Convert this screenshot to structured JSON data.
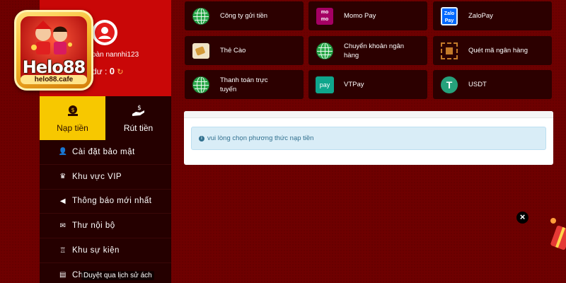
{
  "logo": {
    "text": "Helo88",
    "url": "helo88.cafe"
  },
  "profile": {
    "username": "oàn nannhi123",
    "balance_prefix": "dư :",
    "balance_value": "0"
  },
  "tabs": [
    {
      "label": "Nạp tiền",
      "active": true
    },
    {
      "label": "Rút tiền",
      "active": false
    }
  ],
  "menu": [
    {
      "label": "Cài đặt bảo mật",
      "icon": "user-lock-icon"
    },
    {
      "label": "Khu vực VIP",
      "icon": "crown-icon"
    },
    {
      "label": "Thông báo mới nhất",
      "icon": "megaphone-icon"
    },
    {
      "label": "Thư nội bộ",
      "icon": "envelope-icon"
    },
    {
      "label": "Khu sự kiện",
      "icon": "trophy-icon"
    },
    {
      "label": "Ch",
      "icon": "clipboard-icon"
    }
  ],
  "tooltip": "Duyệt qua lịch sử ách",
  "payments": [
    {
      "label": "Công ty gửi tiền",
      "icon": "globe-icon"
    },
    {
      "label": "Momo Pay",
      "icon": "momo-icon"
    },
    {
      "label": "ZaloPay",
      "icon": "zalopay-icon"
    },
    {
      "label": "Thẻ Cào",
      "icon": "scratch-card-icon"
    },
    {
      "label": "Chuyển khoản ngân hàng",
      "icon": "globe-icon"
    },
    {
      "label": "Quét mã ngân hàng",
      "icon": "qr-scan-icon"
    },
    {
      "label": "Thanh toán trực tuyến",
      "icon": "globe-icon"
    },
    {
      "label": "VTPay",
      "icon": "vtpay-icon"
    },
    {
      "label": "USDT",
      "icon": "usdt-icon"
    }
  ],
  "notice": {
    "text": "vui lòng chọn phương thức nạp tiền"
  },
  "colors": {
    "background": "#6e0000",
    "profile_red": "#c90707",
    "accent_yellow": "#f7c800",
    "panel_dark": "#250000"
  }
}
